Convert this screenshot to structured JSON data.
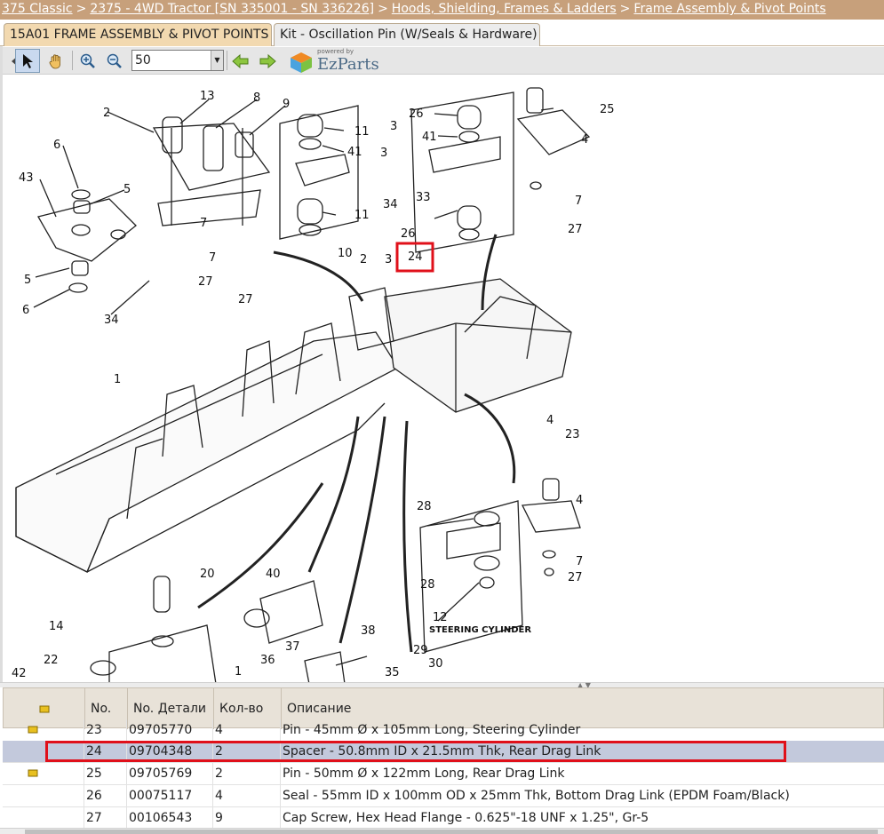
{
  "breadcrumb": [
    {
      "label": "375 Classic"
    },
    {
      "label": "2375 - 4WD Tractor [SN 335001 - SN 336226]"
    },
    {
      "label": "Hoods, Shielding, Frames & Ladders"
    },
    {
      "label": "Frame Assembly & Pivot Points"
    }
  ],
  "breadcrumb_sep": ">",
  "tabs": [
    {
      "label": "15A01 FRAME ASSEMBLY & PIVOT POINTS",
      "active": true
    },
    {
      "label": "Kit - Oscillation Pin (W/Seals & Hardware)",
      "active": false
    }
  ],
  "toolbar": {
    "zoom_value": "50",
    "logo_powered": "powered by",
    "logo_brand": "EzParts"
  },
  "diagram": {
    "callouts": [
      "2",
      "13",
      "8",
      "9",
      "6",
      "5",
      "43",
      "5",
      "6",
      "34",
      "7",
      "7",
      "27",
      "27",
      "11",
      "41",
      "3",
      "34",
      "11",
      "10",
      "3",
      "26",
      "41",
      "33",
      "26",
      "24",
      "25",
      "4",
      "7",
      "27",
      "2",
      "3",
      "1",
      "4",
      "23",
      "28",
      "4",
      "7",
      "28",
      "12",
      "27",
      "20",
      "40",
      "14",
      "22",
      "42",
      "37",
      "36",
      "1",
      "38",
      "35",
      "29",
      "30"
    ],
    "steering_label": "STEERING CYLINDER",
    "highlighted_callout": "24"
  },
  "table": {
    "headers": [
      "No.",
      "No. Детали",
      "Кол-во",
      "Описание"
    ],
    "rows": [
      {
        "no": "23",
        "part": "09705770",
        "qty": "4",
        "desc": "Pin - 45mm Ø x 105mm Long, Steering Cylinder",
        "icon": true,
        "selected": false
      },
      {
        "no": "24",
        "part": "09704348",
        "qty": "2",
        "desc": "Spacer - 50.8mm ID x 21.5mm Thk, Rear Drag Link",
        "icon": false,
        "selected": true
      },
      {
        "no": "25",
        "part": "09705769",
        "qty": "2",
        "desc": "Pin - 50mm Ø x 122mm Long, Rear Drag Link",
        "icon": true,
        "selected": false
      },
      {
        "no": "26",
        "part": "00075117",
        "qty": "4",
        "desc": "Seal - 55mm ID x 100mm OD x 25mm Thk, Bottom Drag Link (EPDM Foam/Black)",
        "icon": false,
        "selected": false
      },
      {
        "no": "27",
        "part": "00106543",
        "qty": "9",
        "desc": "Cap Screw, Hex Head Flange - 0.625\"-18 UNF x 1.25\", Gr-5",
        "icon": false,
        "selected": false
      }
    ]
  },
  "colors": {
    "accent": "#c7a07b",
    "highlight": "#e0101a",
    "selected_row": "#c3c9dc"
  }
}
